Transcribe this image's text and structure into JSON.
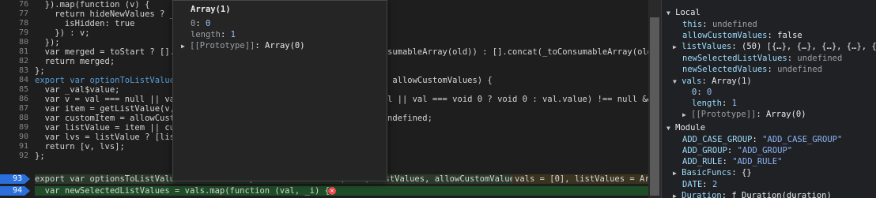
{
  "editor": {
    "line_numbers": [
      "76",
      "77",
      "78",
      "79",
      "80",
      "81",
      "82",
      "83",
      "84",
      "85",
      "86",
      "87",
      "88",
      "89",
      "90",
      "91",
      "92",
      "93",
      "94"
    ],
    "breakpoint_lines": [
      "93",
      "94"
    ],
    "lines": [
      "  }).map(function (v) {",
      "    return hideNewValues ? _",
      "      isHidden: true",
      "    }) : v;",
      "  });",
      "  var merged = toStart ? [].c",
      "  return merged;",
      "};",
      "export var optionToListValue",
      "  var _val$value;",
      "  var v = val === null || val",
      "  var item = getListValue(v,",
      "  var customItem = allowCusto",
      "  var listValue = item || cus",
      "  var lvs = listValue ? [list",
      "  return [v, lvs];",
      "};",
      "export var optionsToListValues = function optionsToListValues(vals, listValues, allowCustomValues) {",
      "  var newSelectedListValues = vals.map(function (val, _i) {"
    ],
    "right_fragments": {
      "81": "sumableArray(old)) : [].concat(_toConsumableArray(old),",
      "84": " allowCustomValues) {",
      "86": "l || val === void 0 ? void 0 : val.value) !== null && _v",
      "88": "ndefined;"
    },
    "inline_value_93": "vals = [0], listValues = Arr",
    "current_line_token": "vals"
  },
  "tooltip": {
    "title": "Array(1)",
    "entry_key": "0",
    "entry_value": "0",
    "length_key": "length",
    "length_value": "1",
    "proto_key": "[[Prototype]]",
    "proto_value": "Array(0)"
  },
  "scope": {
    "local_label": "Local",
    "this_key": "this",
    "this_value": "undefined",
    "allow_key": "allowCustomValues",
    "allow_value": "false",
    "list_key": "listValues",
    "list_value": "(50) [{…}, {…}, {…}, {…}, {…}",
    "nsl_key": "newSelectedListValues",
    "nsl_value": "undefined",
    "nsv_key": "newSelectedValues",
    "nsv_value": "undefined",
    "vals_key": "vals",
    "vals_value": "Array(1)",
    "vals_entry_key": "0",
    "vals_entry_value": "0",
    "vals_length_key": "length",
    "vals_length_value": "1",
    "vals_proto_key": "[[Prototype]]",
    "vals_proto_value": "Array(0)",
    "module_label": "Module",
    "acg_key": "ADD_CASE_GROUP",
    "acg_value": "\"ADD_CASE_GROUP\"",
    "ag_key": "ADD_GROUP",
    "ag_value": "\"ADD_GROUP\"",
    "ar_key": "ADD_RULE",
    "ar_value": "\"ADD_RULE\"",
    "bf_key": "BasicFuncs",
    "bf_value": "{}",
    "date_key": "DATE",
    "date_value": "2",
    "dur_key": "Duration",
    "dur_value": "ƒ Duration(duration)"
  },
  "colors": {
    "breakpoint": "#2a6fdb",
    "current_line": "#1f4d27",
    "error": "#f14c4c"
  }
}
